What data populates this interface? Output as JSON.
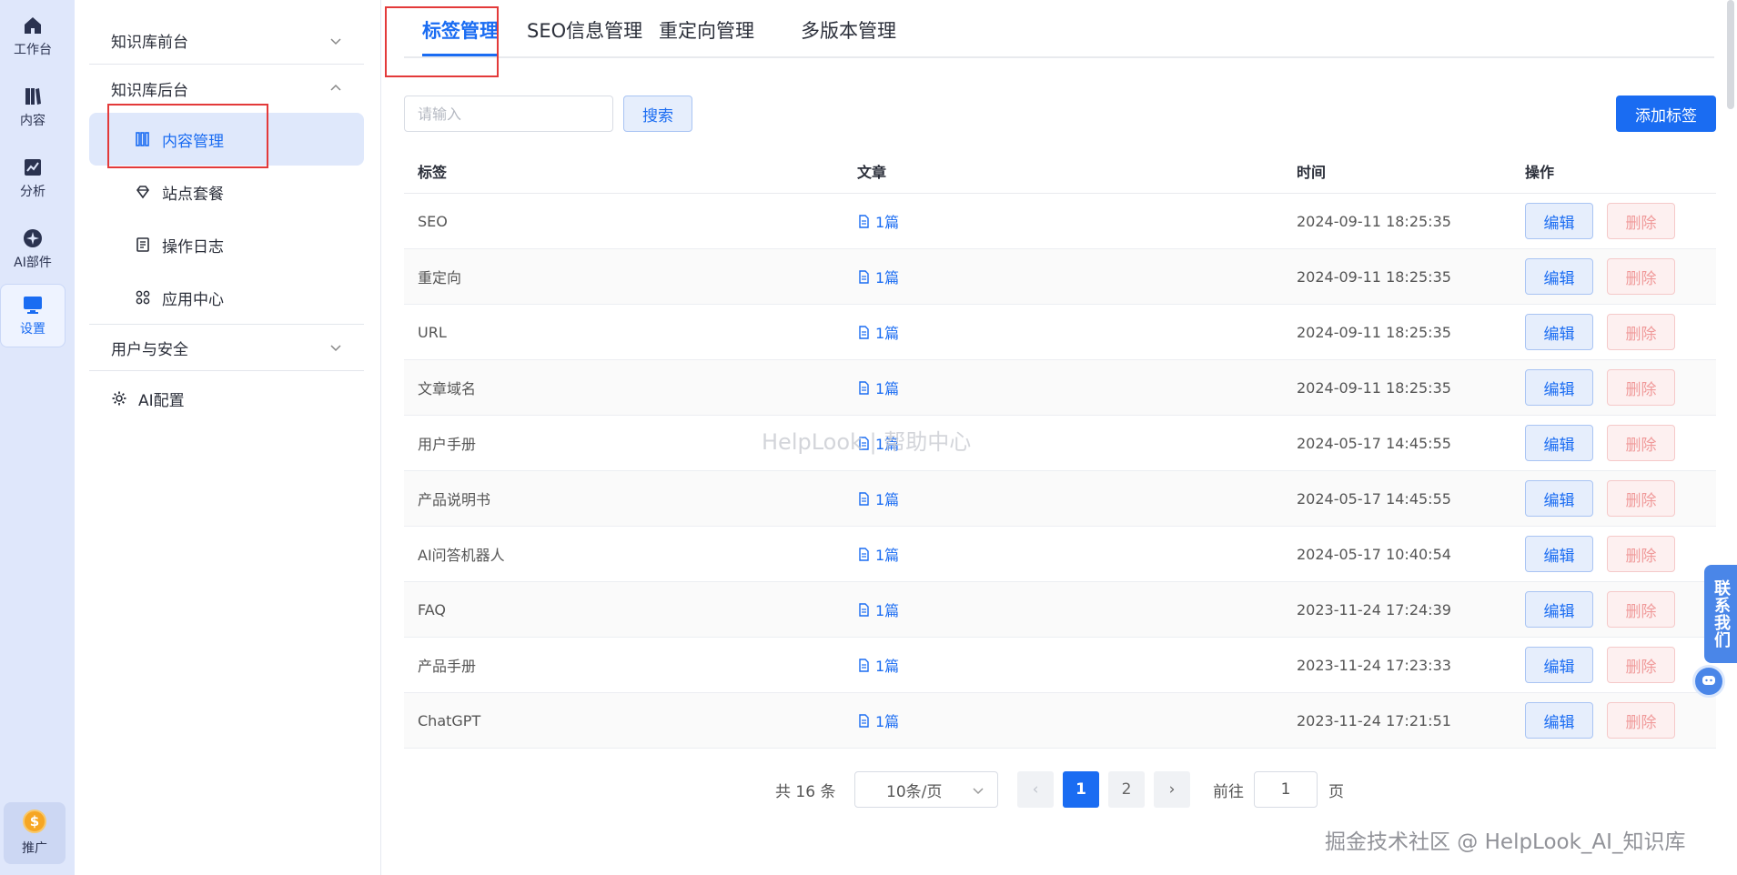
{
  "rail": {
    "items": [
      {
        "label": "工作台",
        "icon": "home-icon"
      },
      {
        "label": "内容",
        "icon": "book-icon"
      },
      {
        "label": "分析",
        "icon": "chart-icon"
      },
      {
        "label": "AI部件",
        "icon": "ai-widget-icon"
      },
      {
        "label": "设置",
        "icon": "monitor-icon",
        "active": true
      }
    ],
    "promo": {
      "label": "推广",
      "coin": "$"
    }
  },
  "sidebar": {
    "groups": [
      {
        "label": "知识库前台",
        "expanded": false
      },
      {
        "label": "知识库后台",
        "expanded": true
      },
      {
        "label": "用户与安全",
        "expanded": false
      }
    ],
    "items": [
      {
        "label": "内容管理",
        "icon": "columns-icon",
        "active": true
      },
      {
        "label": "站点套餐",
        "icon": "diamond-icon"
      },
      {
        "label": "操作日志",
        "icon": "log-icon"
      },
      {
        "label": "应用中心",
        "icon": "apps-icon"
      }
    ],
    "ai_config": {
      "label": "AI配置",
      "icon": "gear-icon"
    }
  },
  "tabs": [
    {
      "label": "标签管理",
      "active": true
    },
    {
      "label": "SEO信息管理"
    },
    {
      "label": "重定向管理"
    },
    {
      "label": "多版本管理"
    }
  ],
  "toolbar": {
    "search_placeholder": "请输入",
    "search_label": "搜索",
    "add_label": "添加标签"
  },
  "table": {
    "columns": [
      "标签",
      "文章",
      "时间",
      "操作"
    ],
    "edit_label": "编辑",
    "delete_label": "删除",
    "rows": [
      {
        "tag": "SEO",
        "articles": "1篇",
        "time": "2024-09-11 18:25:35"
      },
      {
        "tag": "重定向",
        "articles": "1篇",
        "time": "2024-09-11 18:25:35"
      },
      {
        "tag": "URL",
        "articles": "1篇",
        "time": "2024-09-11 18:25:35"
      },
      {
        "tag": "文章域名",
        "articles": "1篇",
        "time": "2024-09-11 18:25:35"
      },
      {
        "tag": "用户手册",
        "articles": "1篇",
        "time": "2024-05-17 14:45:55"
      },
      {
        "tag": "产品说明书",
        "articles": "1篇",
        "time": "2024-05-17 14:45:55"
      },
      {
        "tag": "AI问答机器人",
        "articles": "1篇",
        "time": "2024-05-17 10:40:54"
      },
      {
        "tag": "FAQ",
        "articles": "1篇",
        "time": "2023-11-24 17:24:39"
      },
      {
        "tag": "产品手册",
        "articles": "1篇",
        "time": "2023-11-24 17:23:33"
      },
      {
        "tag": "ChatGPT",
        "articles": "1篇",
        "time": "2023-11-24 17:21:51"
      }
    ]
  },
  "pagination": {
    "total": "共 16 条",
    "page_size": "10条/页",
    "pages": [
      "1",
      "2"
    ],
    "current": "1",
    "goto_label": "前往",
    "goto_value": "1",
    "goto_unit": "页",
    "prev": "‹",
    "next": "›"
  },
  "overlay": {
    "watermark_center": "HelpLook | 帮助中心",
    "watermark_corner": "掘金技术社区 @ HelpLook_AI_知识库",
    "contact_label": "联系我们"
  },
  "colors": {
    "accent": "#1a6cf2",
    "danger": "#f09a9a",
    "highlight_box": "#e33a3a"
  }
}
